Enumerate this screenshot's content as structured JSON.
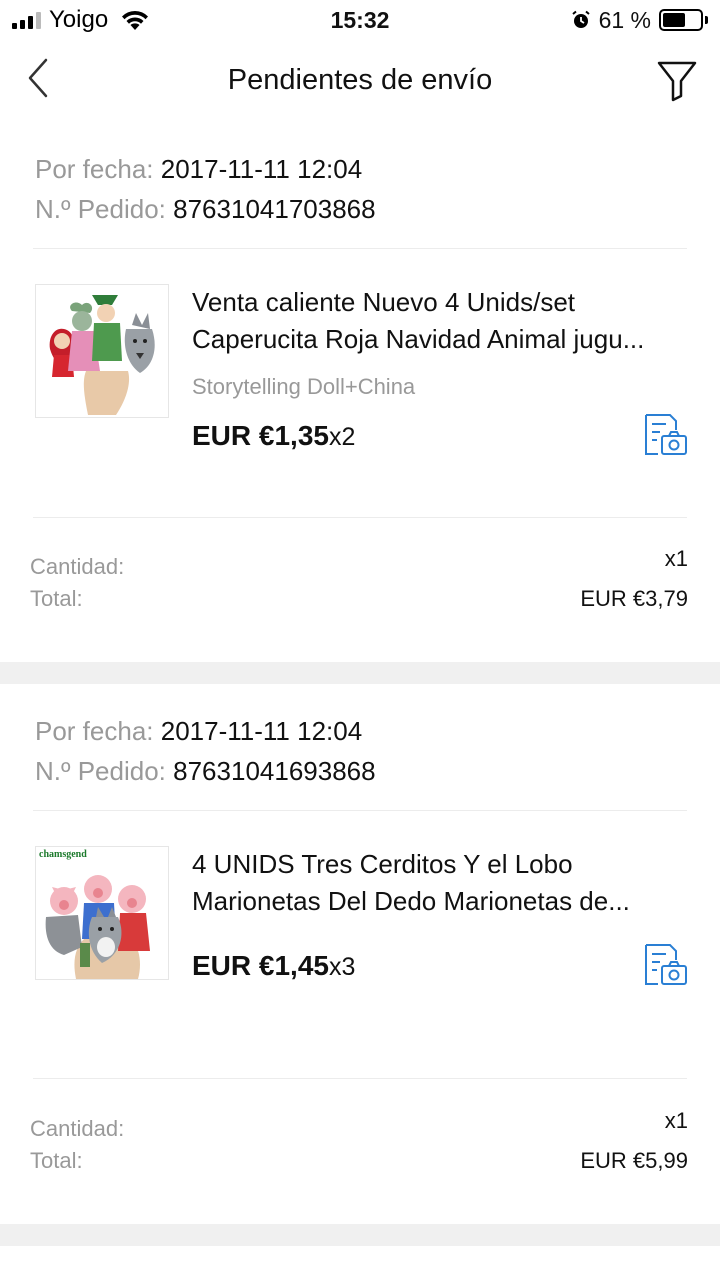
{
  "status_bar": {
    "carrier": "Yoigo",
    "time": "15:32",
    "battery_percent": "61 %",
    "battery_level": 0.61
  },
  "nav": {
    "title": "Pendientes de envío"
  },
  "labels": {
    "date_key": "Por fecha:",
    "order_key": "N.º Pedido:",
    "quantity_key": "Cantidad:",
    "total_key": "Total:"
  },
  "orders": [
    {
      "date": "2017-11-11 12:04",
      "order_number": "87631041703868",
      "product_title": "Venta caliente Nuevo 4 Unids/set Caperucita Roja Navidad Animal jugu...",
      "product_variant": "Storytelling Doll+China",
      "price": "EUR €1,35",
      "qty": "x2",
      "quantity": "x1",
      "total": "EUR €3,79"
    },
    {
      "date": "2017-11-11 12:04",
      "order_number": "87631041693868",
      "product_title": "4 UNIDS Tres Cerditos Y el Lobo Marionetas Del Dedo Marionetas de...",
      "thumb_watermark": "chamsgend",
      "price": "EUR €1,45",
      "qty": "x3",
      "quantity": "x1",
      "total": "EUR €5,99"
    }
  ],
  "colors": {
    "accent": "#2a7fd4",
    "muted_text": "#999999",
    "separator": "#f0f0f0"
  }
}
